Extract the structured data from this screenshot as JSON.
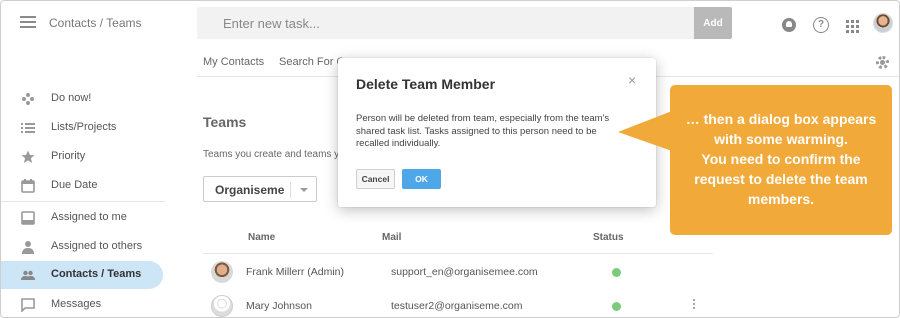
{
  "header": {
    "title": "Contacts / Teams",
    "task_placeholder": "Enter new task...",
    "add_label": "Add",
    "help_glyph": "?"
  },
  "subnav": {
    "items": [
      "My Contacts",
      "Search For C"
    ]
  },
  "sidebar": {
    "items": [
      {
        "label": "Do now!",
        "icon": "gamepad-icon"
      },
      {
        "label": "Lists/Projects",
        "icon": "list-icon"
      },
      {
        "label": "Priority",
        "icon": "star-icon"
      },
      {
        "label": "Due Date",
        "icon": "calendar-icon"
      },
      {
        "label": "Assigned to me",
        "icon": "inbox-icon"
      },
      {
        "label": "Assigned to others",
        "icon": "person-icon"
      },
      {
        "label": "Contacts / Teams",
        "icon": "people-icon"
      },
      {
        "label": "Messages",
        "icon": "chat-icon"
      }
    ],
    "active_color": "#cde6f7"
  },
  "main": {
    "title": "Teams",
    "description": "Teams you create and teams y",
    "team_select": "Organiseme",
    "table": {
      "headers": [
        "Name",
        "Mail",
        "Status"
      ],
      "rows": [
        {
          "name": "Frank Millerr (Admin)",
          "mail": "support_en@organisemee.com",
          "status_color": "#7ccb7c"
        },
        {
          "name": "Mary Johnson",
          "mail": "testuser2@organiseme.com",
          "status_color": "#7ccb7c"
        }
      ]
    }
  },
  "modal": {
    "title": "Delete Team Member",
    "close_glyph": "×",
    "body_lines": [
      "Person will be deleted from team, especially from the team's",
      "shared task list. Tasks assigned to this person need to be",
      "recalled individually."
    ],
    "cancel_label": "Cancel",
    "ok_label": "OK",
    "ok_color": "#4ea8e8"
  },
  "callout": {
    "lines": [
      "… then a dialog box appears",
      "with some warming.",
      "You need to confirm the",
      "request to delete the team",
      "members."
    ],
    "color": "#f1a93a"
  }
}
